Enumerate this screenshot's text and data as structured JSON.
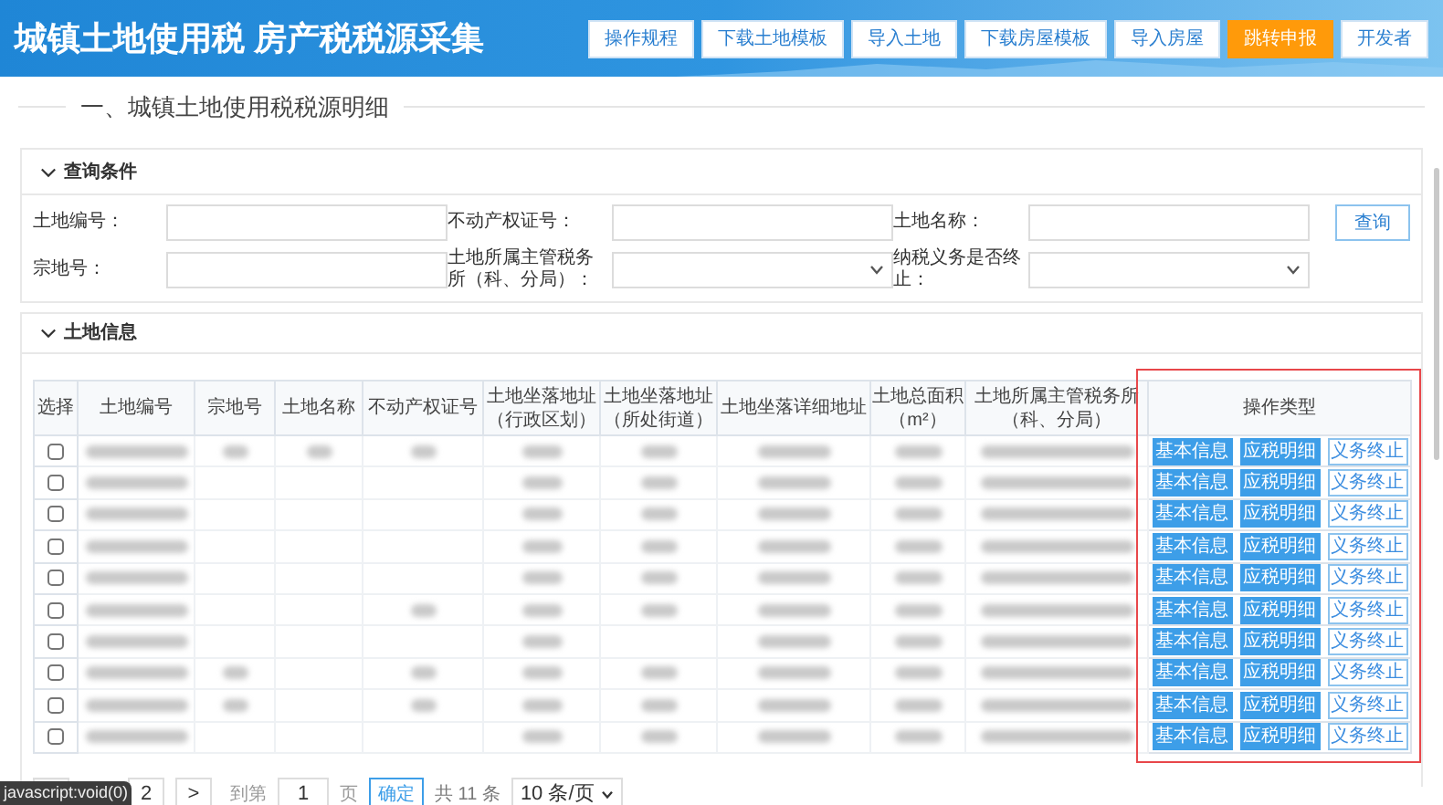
{
  "header": {
    "title": "城镇土地使用税 房产税税源采集",
    "buttons": [
      {
        "label": "操作规程",
        "highlighted": false
      },
      {
        "label": "下载土地模板",
        "highlighted": false
      },
      {
        "label": "导入土地",
        "highlighted": false
      },
      {
        "label": "下载房屋模板",
        "highlighted": false
      },
      {
        "label": "导入房屋",
        "highlighted": false
      },
      {
        "label": "跳转申报",
        "highlighted": true
      },
      {
        "label": "开发者",
        "highlighted": false
      }
    ]
  },
  "section_title": "一、城镇土地使用税税源明细",
  "query_panel": {
    "title": "查询条件",
    "expanded": true,
    "fields": [
      {
        "label": "土地编号：",
        "kind": "text"
      },
      {
        "label": "不动产权证号：",
        "kind": "text"
      },
      {
        "label": "土地名称：",
        "kind": "text"
      },
      {
        "label": "宗地号：",
        "kind": "text"
      },
      {
        "label": "土地所属主管税务所（科、分局）：",
        "kind": "select"
      },
      {
        "label": "纳税义务是否终止：",
        "kind": "select"
      }
    ],
    "search_button": "查询"
  },
  "land_panel": {
    "title": "土地信息",
    "expanded": true
  },
  "table": {
    "columns": [
      {
        "lines": [
          "选择"
        ]
      },
      {
        "lines": [
          "土地编号"
        ]
      },
      {
        "lines": [
          "宗地号"
        ]
      },
      {
        "lines": [
          "土地名称"
        ]
      },
      {
        "lines": [
          "不动产权证号"
        ]
      },
      {
        "lines": [
          "土地坐落地址",
          "（行政区划）"
        ]
      },
      {
        "lines": [
          "土地坐落地址",
          "（所处街道）"
        ]
      },
      {
        "lines": [
          "土地坐落详细地址"
        ]
      },
      {
        "lines": [
          "土地总面积",
          "（m²）"
        ]
      },
      {
        "lines": [
          "土地所属主管税务所",
          "（科、分局）"
        ]
      },
      {
        "lines": [
          "操作类型"
        ]
      }
    ],
    "highlighted_column": true,
    "rows": [
      {
        "checked": false,
        "blurred": [
          true,
          true,
          true,
          true,
          true,
          true,
          true,
          true,
          true
        ],
        "actions": [
          "基本信息",
          "应税明细",
          "义务终止"
        ]
      },
      {
        "checked": false,
        "blurred": [
          true,
          false,
          false,
          false,
          true,
          true,
          true,
          true,
          true
        ],
        "actions": [
          "基本信息",
          "应税明细",
          "义务终止"
        ]
      },
      {
        "checked": false,
        "blurred": [
          true,
          false,
          false,
          false,
          true,
          true,
          true,
          true,
          true
        ],
        "actions": [
          "基本信息",
          "应税明细",
          "义务终止"
        ]
      },
      {
        "checked": false,
        "blurred": [
          true,
          false,
          false,
          false,
          true,
          true,
          true,
          true,
          true
        ],
        "actions": [
          "基本信息",
          "应税明细",
          "义务终止"
        ]
      },
      {
        "checked": false,
        "blurred": [
          true,
          false,
          false,
          false,
          true,
          true,
          true,
          true,
          true
        ],
        "actions": [
          "基本信息",
          "应税明细",
          "义务终止"
        ]
      },
      {
        "checked": false,
        "blurred": [
          true,
          false,
          false,
          true,
          true,
          true,
          true,
          true,
          true
        ],
        "actions": [
          "基本信息",
          "应税明细",
          "义务终止"
        ]
      },
      {
        "checked": false,
        "blurred": [
          true,
          false,
          false,
          false,
          true,
          false,
          true,
          true,
          true
        ],
        "actions": [
          "基本信息",
          "应税明细",
          "义务终止"
        ]
      },
      {
        "checked": false,
        "blurred": [
          true,
          true,
          false,
          true,
          true,
          true,
          true,
          true,
          true
        ],
        "actions": [
          "基本信息",
          "应税明细",
          "义务终止"
        ]
      },
      {
        "checked": false,
        "blurred": [
          true,
          true,
          false,
          true,
          true,
          true,
          true,
          true,
          true
        ],
        "actions": [
          "基本信息",
          "应税明细",
          "义务终止"
        ]
      },
      {
        "checked": false,
        "blurred": [
          true,
          false,
          false,
          false,
          true,
          true,
          true,
          true,
          true
        ],
        "actions": [
          "基本信息",
          "应税明细",
          "义务终止"
        ]
      }
    ]
  },
  "pagination": {
    "pages": [
      {
        "label": "2",
        "selected": false
      }
    ],
    "next": ">",
    "goto_label": "到第",
    "goto_value": "1",
    "page_unit": "页",
    "confirm": "确定",
    "total": "共 11 条",
    "page_size": "10 条/页"
  },
  "status_url": "javascript:void(0)"
}
